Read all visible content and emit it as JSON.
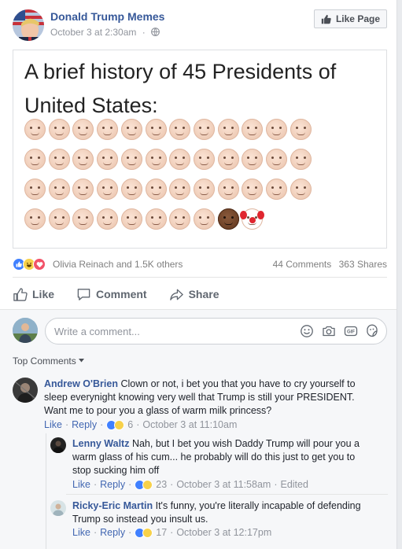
{
  "post": {
    "page_name": "Donald Trump Memes",
    "timestamp": "October 3 at 2:30am",
    "like_page_label": "Like Page",
    "meme_title": "A brief history of 45 Presidents of United States:",
    "reactions_text": "Olivia Reinach and 1.5K others",
    "comments_count": "44 Comments",
    "shares_count": "363 Shares"
  },
  "actions": {
    "like": "Like",
    "comment": "Comment",
    "share": "Share"
  },
  "composer": {
    "placeholder": "Write a comment..."
  },
  "top_comments_label": "Top Comments",
  "comments": [
    {
      "author": "Andrew O'Brien",
      "text": "Clown or not, i bet you that you have to cry yourself to sleep everynight knowing very well that Trump is still your PRESIDENT. Want me to pour you a glass of warm milk princess?",
      "like": "Like",
      "reply": "Reply",
      "reactions": "6",
      "time": "October 3 at 11:10am"
    },
    {
      "author": "Lenny Waltz",
      "text": "Nah, but I bet you wish Daddy Trump will pour you a warm glass of his cum... he probably will do this just to get you to stop sucking him off",
      "like": "Like",
      "reply": "Reply",
      "reactions": "23",
      "time": "October 3 at 11:58am",
      "edited": "Edited"
    },
    {
      "author": "Ricky-Eric Martin",
      "text": "It's funny, you're literally incapable of defending Trump so instead you insult us.",
      "like": "Like",
      "reply": "Reply",
      "reactions": "17",
      "time": "October 3 at 12:17pm"
    }
  ],
  "colors": {
    "link": "#365899",
    "meta": "#90949c",
    "like_react": "#4080ff",
    "haha_react": "#f7d14a",
    "love_react": "#f25268"
  },
  "icons": [
    "globe-icon",
    "thumbs-up-icon",
    "speech-bubble-icon",
    "share-arrow-icon",
    "emoji-icon",
    "camera-icon",
    "gif-icon",
    "sticker-icon",
    "caret-down-icon"
  ],
  "meme_faces": {
    "rows": 4,
    "per_row": 12,
    "last_row_plain": 8,
    "special": [
      "dark-skin-face",
      "clown-face"
    ]
  }
}
